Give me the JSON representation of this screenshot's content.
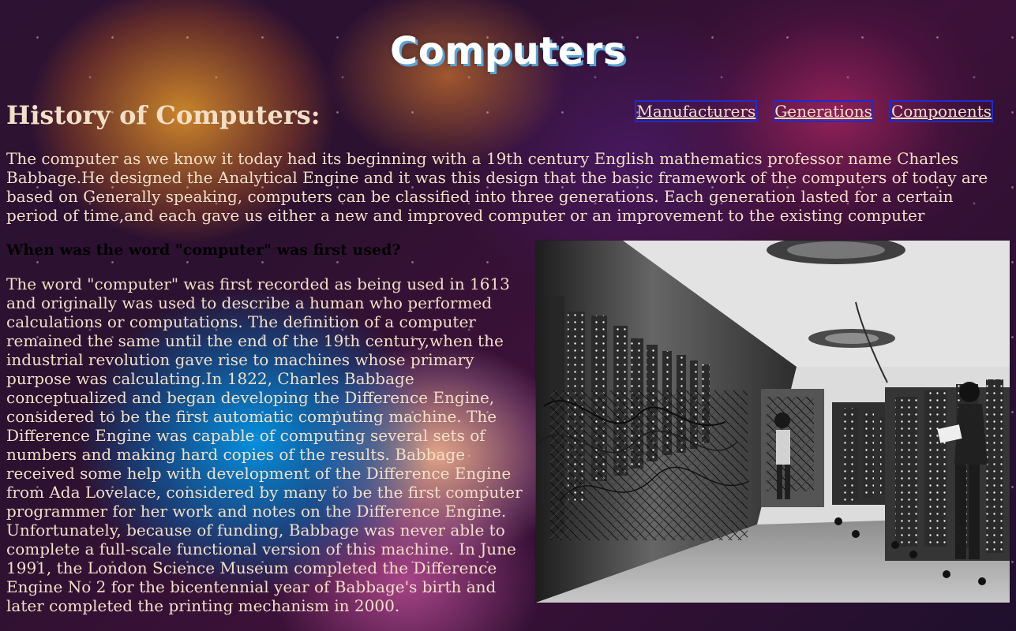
{
  "header": {
    "title": "Computers",
    "section_heading": "History of Computers:"
  },
  "nav": {
    "items": [
      {
        "label": "Manufacturers"
      },
      {
        "label": "Generations"
      },
      {
        "label": "Components"
      }
    ]
  },
  "intro": {
    "text": "The computer as we know it today had its beginning with a 19th century English mathematics professor name Charles Babbage.He designed the Analytical Engine and it was this design that the basic framework of the computers of today are based on Generally speaking, computers can be classified into three generations. Each generation lasted for a certain period of time,and each gave us either a new and improved computer or an improvement to the existing computer"
  },
  "history": {
    "question": "When was the word \"computer\" was first used?",
    "text": "The word \"computer\" was first recorded as being used in 1613 and originally was used to describe a human who performed calculations or computations. The definition of a computer remained the same until the end of the 19th century,when the industrial revolution gave rise to machines whose primary purpose was calculating.In 1822, Charles Babbage conceptualized and began developing the Difference Engine, considered to be the first automatic computing machine. The Difference Engine was capable of computing several sets of numbers and making hard copies of the results. Babbage received some help with development of the Difference Engine from Ada Lovelace, considered by many to be the first computer programmer for her work and notes on the Difference Engine. Unfortunately, because of funding, Babbage was never able to complete a full-scale functional version of this machine. In June 1991, the London Science Museum completed the Difference Engine No 2 for the bicentennial year of Babbage's birth and later completed the printing mechanism in 2000."
  },
  "colors": {
    "text": "#f3dfc7",
    "nav_border": "#1d2bd2",
    "question": "#000000"
  }
}
